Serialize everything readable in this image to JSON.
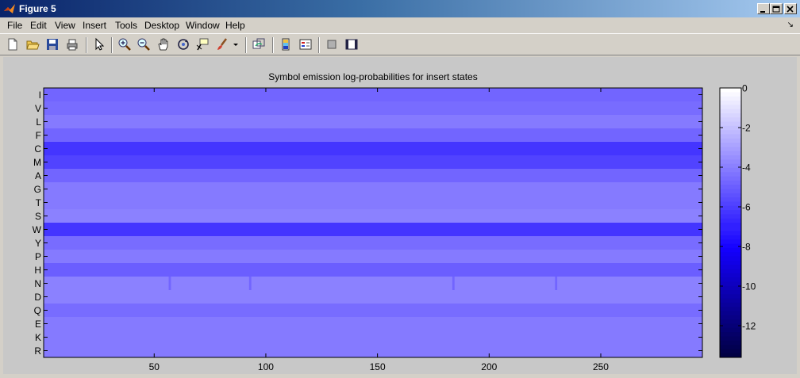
{
  "window": {
    "title": "Figure 5"
  },
  "menu": [
    "File",
    "Edit",
    "View",
    "Insert",
    "Tools",
    "Desktop",
    "Window",
    "Help"
  ],
  "toolbar": [
    "new-figure-icon",
    "open-file-icon",
    "save-icon",
    "print-icon",
    "edit-plot-arrow-icon",
    "zoom-in-icon",
    "zoom-out-icon",
    "pan-hand-icon",
    "rotate-3d-icon",
    "data-cursor-icon",
    "brush-icon",
    "brush-dropdown-icon",
    "link-plot-icon",
    "colorbar-icon",
    "legend-icon",
    "hide-plot-tools-icon",
    "show-plot-tools-icon"
  ],
  "chart_data": {
    "type": "heatmap",
    "title": "Symbol emission log-probabilities for insert states",
    "rows": [
      "I",
      "V",
      "L",
      "F",
      "C",
      "M",
      "A",
      "G",
      "T",
      "S",
      "W",
      "Y",
      "P",
      "H",
      "N",
      "D",
      "Q",
      "E",
      "K",
      "R"
    ],
    "row_values": [
      -4.7,
      -4.5,
      -4.2,
      -4.8,
      -6.3,
      -5.8,
      -4.7,
      -4.1,
      -4.2,
      -3.9,
      -6.2,
      -4.6,
      -4.2,
      -4.9,
      -3.8,
      -3.9,
      -4.6,
      -4.0,
      -4.0,
      -4.0
    ],
    "x_ticks": [
      50,
      100,
      150,
      200,
      250
    ],
    "x_range": [
      1,
      295
    ],
    "n_columns": 295,
    "column_highlights": [
      {
        "row": "N",
        "columns": [
          57,
          93,
          184,
          230
        ],
        "value": -4.8
      }
    ],
    "colorbar": {
      "ticks": [
        0,
        -2,
        -4,
        -6,
        -8,
        -10,
        -12
      ],
      "range": [
        -13.6,
        0
      ],
      "levels": 64
    },
    "grid": false,
    "legend": "colorbar-right"
  }
}
